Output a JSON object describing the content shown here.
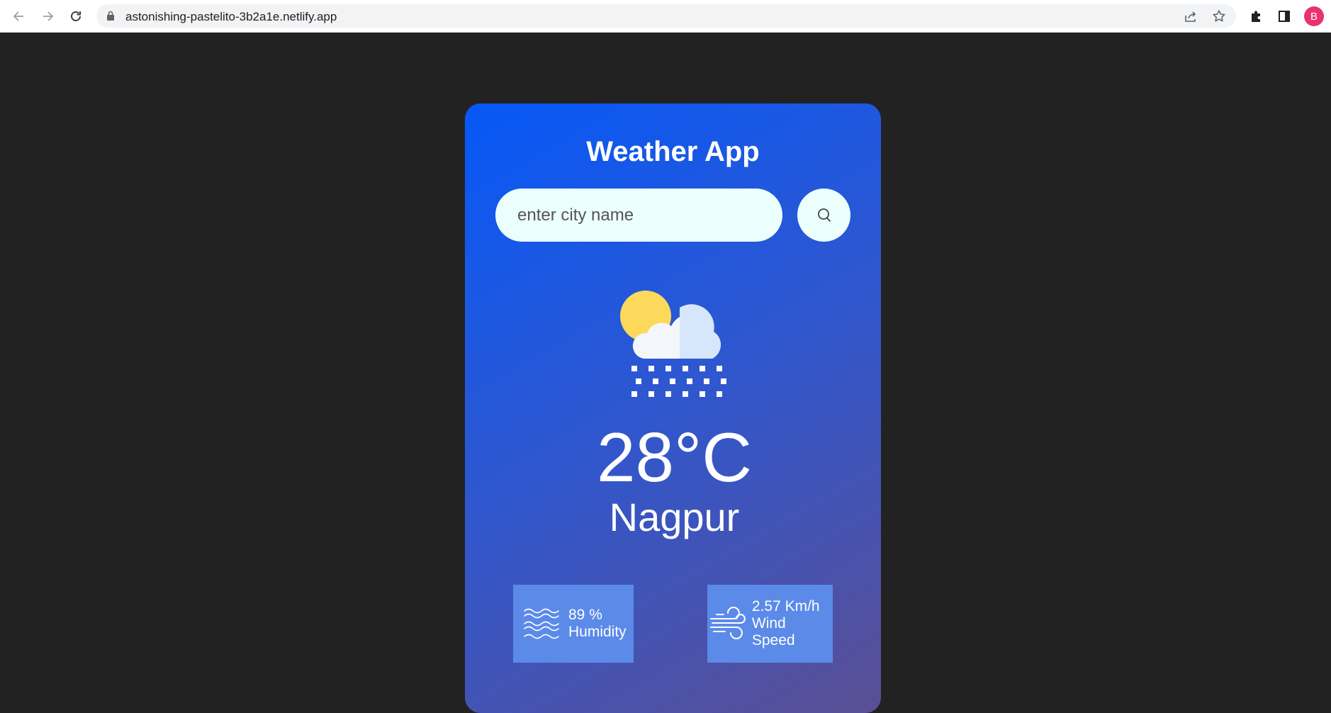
{
  "browser": {
    "url": "astonishing-pastelito-3b2a1e.netlify.app",
    "profile_initial": "B",
    "profile_color": "#e8336d"
  },
  "app": {
    "title": "Weather App",
    "search": {
      "placeholder": "enter city name",
      "value": ""
    },
    "weather_icon": "sun-cloud-snow-icon",
    "temperature": "28°C",
    "city": "Nagpur",
    "humidity": {
      "value": "89 %",
      "label": "Humidity",
      "icon": "humidity-waves-icon"
    },
    "wind": {
      "value": "2.57 Km/h",
      "label": "Wind Speed",
      "icon": "wind-icon"
    }
  },
  "colors": {
    "page_background": "#222222",
    "card_gradient_start": "#0658f8",
    "card_gradient_end": "#5a4f94",
    "input_background": "#ebfffc",
    "detail_box": "#5b8ae9"
  }
}
